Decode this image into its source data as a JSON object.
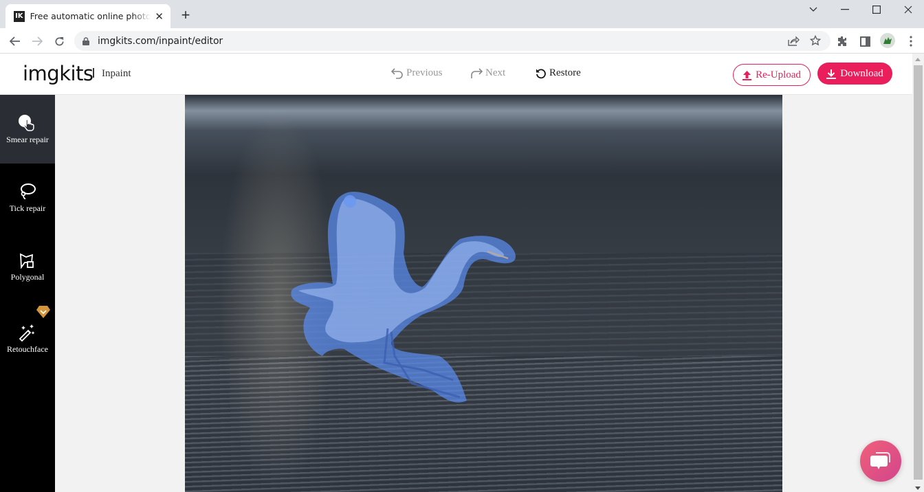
{
  "browser": {
    "tab": {
      "favicon_text": "IK",
      "title": "Free automatic online photo retouch"
    },
    "url": "imgkits.com/inpaint/editor"
  },
  "header": {
    "logo": "imgkits",
    "section": "Inpaint",
    "previous_label": "Previous",
    "next_label": "Next",
    "restore_label": "Restore",
    "reupload_label": "Re-Upload",
    "download_label": "Download"
  },
  "sidebar": {
    "items": [
      {
        "label": "Smear repair",
        "icon": "smear-icon",
        "active": true
      },
      {
        "label": "Tick repair",
        "icon": "lasso-icon",
        "active": false
      },
      {
        "label": "Polygonal",
        "icon": "polygon-icon",
        "active": false
      },
      {
        "label": "Retouchface",
        "icon": "magic-wand-icon",
        "active": false,
        "premium": true
      }
    ]
  },
  "canvas": {
    "image_subject": "egret in flight over water",
    "mask_color": "#5a8cf0"
  },
  "colors": {
    "brand": "#e91e5a",
    "sidebar_bg": "#000000",
    "sidebar_active": "#2a2d33",
    "premium_badge": "#d4943a"
  }
}
